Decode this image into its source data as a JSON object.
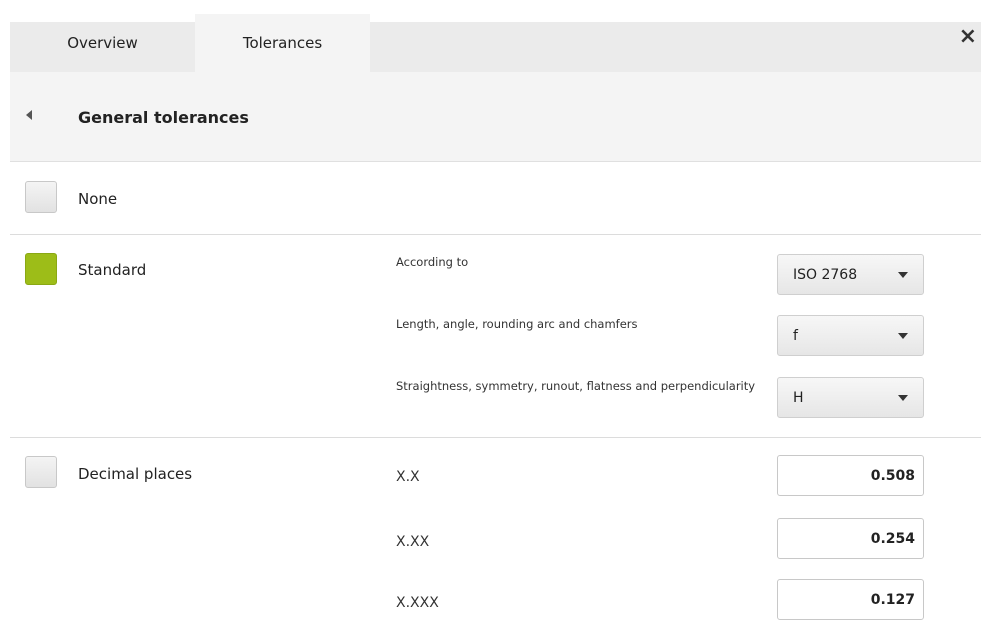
{
  "tabs": [
    {
      "label": "Overview",
      "active": false
    },
    {
      "label": "Tolerances",
      "active": true
    }
  ],
  "close_icon": "×",
  "section": {
    "title": "General tolerances",
    "back_icon": "back-arrow-icon"
  },
  "options": {
    "none": {
      "label": "None",
      "checked": false
    },
    "standard": {
      "label": "Standard",
      "checked": true,
      "fields": [
        {
          "label": "According to",
          "value": "ISO 2768"
        },
        {
          "label": "Length, angle, rounding arc and chamfers",
          "value": "f"
        },
        {
          "label": "Straightness, symmetry, runout, flatness and perpendicularity",
          "value": "H"
        }
      ]
    },
    "decimal": {
      "label": "Decimal places",
      "checked": false,
      "fields": [
        {
          "label": "X.X",
          "value": "0.508"
        },
        {
          "label": "X.XX",
          "value": "0.254"
        },
        {
          "label": "X.XXX",
          "value": "0.127"
        }
      ]
    }
  },
  "colors": {
    "accent_checked": "#9dbd18",
    "tab_active_bg": "#f4f4f4",
    "tab_inactive_bg": "#ebebeb"
  }
}
